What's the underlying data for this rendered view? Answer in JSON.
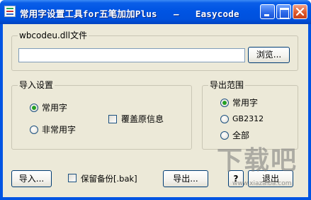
{
  "window": {
    "title": "常用字设置工具for五笔加加Plus   —   Easycode",
    "controls": {
      "minimize_icon": "minimize-icon",
      "maximize_icon": "maximize-icon",
      "close_icon": "close-icon"
    }
  },
  "dll_group": {
    "label": "wbcodeu.dll文件",
    "path_value": "",
    "browse_button": "浏览..."
  },
  "import_group": {
    "label": "导入设置",
    "radio_common": "常用字",
    "radio_uncommon": "非常用字",
    "checkbox_overwrite": "覆盖原信息"
  },
  "export_group": {
    "label": "导出范围",
    "radio_common": "常用字",
    "radio_gb2312": "GB2312",
    "radio_all": "全部"
  },
  "bottom": {
    "import_button": "导入...",
    "backup_checkbox": "保留备份[.bak]",
    "export_button": "导出...",
    "help_button": "?",
    "exit_button": "退出"
  },
  "watermark": {
    "text": "下载吧",
    "subtext": "www.xiazaiba.com"
  },
  "colors": {
    "title_bar": "#0054e3",
    "dialog_bg": "#ece9d8",
    "close_button": "#e05a2c",
    "radio_dot": "#21a121"
  }
}
